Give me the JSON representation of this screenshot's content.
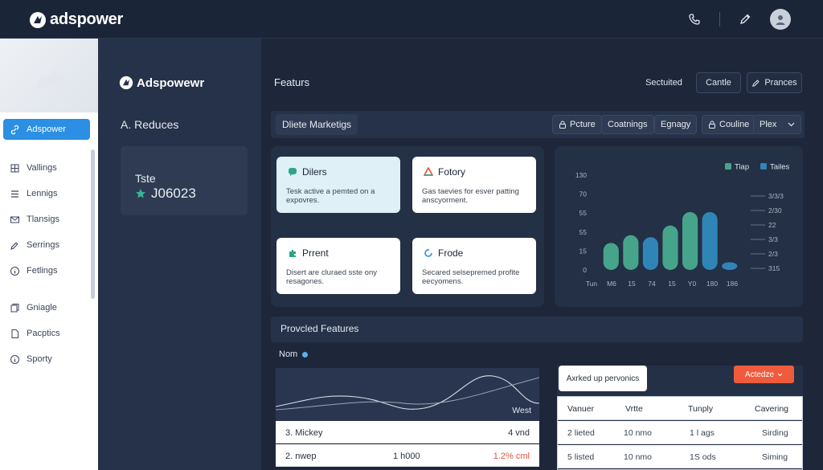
{
  "app": {
    "name": "adspower"
  },
  "topbar": {
    "icons": [
      "phone-icon",
      "pen-icon",
      "user-avatar-icon"
    ]
  },
  "sidebar": {
    "items": [
      {
        "label": "Adspower",
        "icon": "link-icon",
        "active": true
      },
      {
        "label": "Vallings",
        "icon": "grid-icon"
      },
      {
        "label": "Lennigs",
        "icon": "list-icon"
      },
      {
        "label": "Tlansigs",
        "icon": "mail-icon"
      },
      {
        "label": "Serrings",
        "icon": "edit-icon"
      },
      {
        "label": "Fetlings",
        "icon": "info-icon"
      },
      {
        "label": "Gniagle",
        "icon": "copy-icon"
      },
      {
        "label": "Pacptics",
        "icon": "page-icon"
      },
      {
        "label": "Sporty",
        "icon": "info-icon"
      }
    ]
  },
  "column2": {
    "logo": "Adspowewr",
    "title": "A. Reduces",
    "stat": {
      "label": "Tste",
      "value": "J06023",
      "icon": "star-icon"
    }
  },
  "main": {
    "title": "Featurs",
    "header_buttons": {
      "secondary": "Sectuited",
      "primary": "Cantle",
      "action": "Prances"
    },
    "toolbar": {
      "title": "Dliete Marketigs",
      "chips": [
        "Pcture",
        "Coatnings",
        "Egnagy",
        "Couline",
        "Plex"
      ]
    },
    "features": [
      {
        "title": "Dilers",
        "desc": "Tesk active a pemted on a expovres.",
        "icon": "chat-icon",
        "color": "#2fa38a"
      },
      {
        "title": "Fotory",
        "desc": "Gas taevies for esver patting anscyorment.",
        "icon": "drive-icon",
        "color": "#e0533b"
      },
      {
        "title": "Prrent",
        "desc": "Disert are cluraed sste ony resagones.",
        "icon": "puzzle-icon",
        "color": "#2fa38a"
      },
      {
        "title": "Frode",
        "desc": "Secared selsepremed profite eecyomens.",
        "icon": "refresh-icon",
        "color": "#2b8fe3"
      }
    ],
    "chart_data": {
      "type": "bar",
      "categories": [
        "Tun",
        "M6",
        "15",
        "74",
        "15",
        "Y0",
        "180",
        "186"
      ],
      "series": [
        {
          "name": "Tiap",
          "color": "#46a48b",
          "values": [
            14,
            18,
            19,
            26,
            36,
            37,
            3
          ]
        },
        {
          "name": "Tailes",
          "color": "#2f85b6",
          "values": []
        }
      ],
      "bar_values": [
        14,
        18,
        17,
        23,
        30,
        30,
        4
      ],
      "bar_colors": [
        "#46a48b",
        "#46a48b",
        "#2f85b6",
        "#46a48b",
        "#46a48b",
        "#2f85b6",
        "#2f85b6"
      ],
      "y_ticks_left": [
        "130",
        "70",
        "55",
        "55",
        "15",
        "0"
      ],
      "y_ticks_right": [
        "3/3/3",
        "2/30",
        "22",
        "3/3",
        "2/3",
        "315"
      ],
      "ylim": [
        0,
        45
      ],
      "legend": "top-right",
      "grid": false
    },
    "provided": {
      "title": "Provcled Features",
      "legend_label": "Nom",
      "table_header": "West",
      "rows": [
        {
          "name": "3. Mickey",
          "mid": "",
          "value": "4 vnd",
          "value_color": "#2a3340"
        },
        {
          "name": "2. nwep",
          "mid": "1 h000",
          "value": "1.2% cml",
          "value_color": "#e0533b"
        }
      ]
    },
    "ranking": {
      "card_label": "Axrked up pervonics",
      "action_label": "Actedze",
      "columns": [
        "Vanuer",
        "Vrtte",
        "Tunply",
        "Cavering"
      ],
      "rows": [
        [
          "2 lieted",
          "10 nmo",
          "1 l ags",
          "Sirding"
        ],
        [
          "5 listed",
          "10 nmo",
          "1S ods",
          "Siming"
        ]
      ]
    }
  }
}
